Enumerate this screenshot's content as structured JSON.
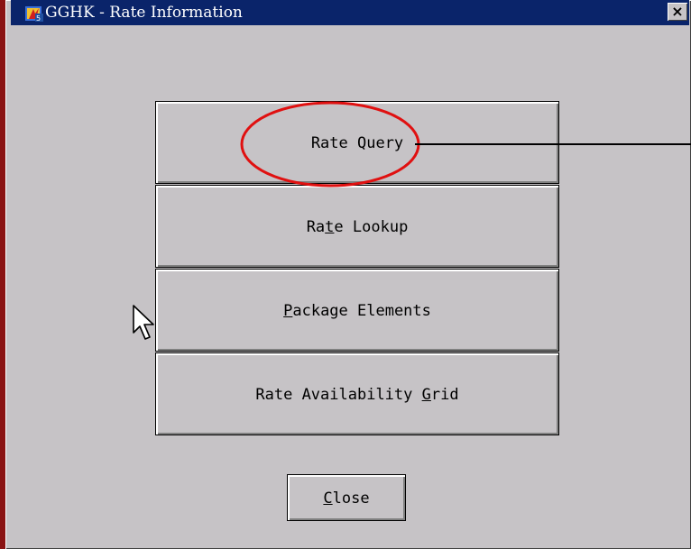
{
  "window": {
    "title": "GGHK - Rate Information",
    "close_glyph": "×",
    "icon": "app-icon"
  },
  "buttons": [
    {
      "label": "Rate Query",
      "name": "rate-query-button"
    },
    {
      "label": "Rate Lookup",
      "name": "rate-lookup-button"
    },
    {
      "label": "Package Elements",
      "name": "package-elements-button"
    },
    {
      "label": "Rate Availability Grid",
      "name": "rate-availability-grid-button"
    }
  ],
  "footer": {
    "close_label": "Close"
  },
  "annotation": {
    "circle_color": "#e01010",
    "line_color": "#000000",
    "highlighted": "Rate Query"
  },
  "colors": {
    "title_bar": "#0a246a",
    "face": "#c6c3c6",
    "frame": "#8a1212"
  }
}
